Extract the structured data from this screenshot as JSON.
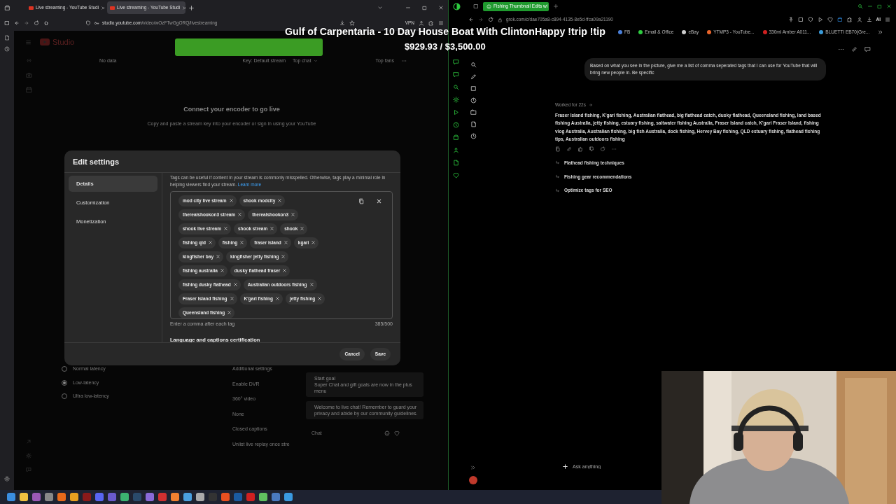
{
  "overlay": {
    "stream_title": "Gulf of Carpentaria - 10 Day House Boat With ClintonHappy !trip !tip",
    "goal": "$929.93 / $3,500.00"
  },
  "left_browser": {
    "tabs": [
      {
        "label": "Live streaming - YouTube Studi",
        "selected": false
      },
      {
        "label": "Live streaming - YouTube Studi",
        "selected": true
      }
    ],
    "url_host": "studio.youtube.com",
    "url_path": "/video/wOzFTwGgORQ/livestreaming",
    "vpn": "VPN"
  },
  "studio": {
    "logo": "Studio",
    "no_data": "No data",
    "stream_key": "Key: Default stream",
    "chat_mode": "Top chat",
    "top_fans": "Top fans",
    "heading": "Connect your encoder to go live",
    "subtext": "Copy and paste a stream key into your encoder or sign in using your YouTube",
    "latency_options": [
      {
        "label": "Normal latency",
        "selected": false
      },
      {
        "label": "Low-latency",
        "selected": true
      },
      {
        "label": "Ultra low-latency",
        "selected": false
      }
    ],
    "additional_settings": {
      "title": "Additional settings",
      "items": [
        "Enable DVR",
        "360° video",
        "None",
        "Closed captions",
        "Unlist live replay once stre"
      ]
    },
    "chat_messages": [
      {
        "title": "Start goal",
        "body": "Super Chat and gift goals are now in the plus menu"
      },
      {
        "body": "Welcome to live chat! Remember to guard your privacy and abide by our community guidelines."
      }
    ],
    "chat_placeholder": "Chat"
  },
  "dialog": {
    "title": "Edit settings",
    "nav": [
      {
        "label": "Details",
        "selected": true
      },
      {
        "label": "Customization",
        "selected": false
      },
      {
        "label": "Monetization",
        "selected": false
      }
    ],
    "help_text": "Tags can be useful if content in your stream is commonly misspelled. Otherwise, tags play a minimal role in helping viewers find your stream.",
    "help_link": "Learn more",
    "tags": [
      "mod city live stream",
      "shook modcity",
      "therealshookon3 stream",
      "therealshookon3",
      "shook live stream",
      "shook stream",
      "shook",
      "fishing qld",
      "fishing",
      "fraser island",
      "kgari",
      "kingfisher bay",
      "kingfisher jetty fishing",
      "fishing australia",
      "dusky flathead fraser",
      "fishing dusky flathead",
      "Australian outdoors fishing",
      "Fraser Island fishing",
      "K'gari fishing",
      "jetty fishing",
      "Queensland fishing"
    ],
    "hint": "Enter a comma after each tag",
    "counter": "385/500",
    "next_section": "Language and captions certification",
    "buttons": [
      "Cancel",
      "Save"
    ]
  },
  "right_browser": {
    "tab": {
      "label": "Fishing Thumbnail Edits wi",
      "selected": true
    },
    "url": "grok.com/c/dae705a8-c894-4135-8e5d-ffca09a21190",
    "ai_label": "AI",
    "bookmarks": [
      "FB",
      "Email & Office",
      "eBay",
      "YTMP3 - YouTube...",
      "330ml Amber A011...",
      "BLUETTI EB70(Gre..."
    ]
  },
  "grok": {
    "prompt": "Based on what you see in the picture, give me a list of comma seperated tags that I can use for YouTube that will bring new people in. Be specific",
    "status": "Worked for 22s",
    "answer": "Fraser Island fishing, K'gari fishing, Australian flathead, big flathead catch, dusky flathead, Queensland fishing, land based fishing Australia, jetty fishing, estuary fishing, saltwater fishing Australia, Fraser Island catch, K'gari Fraser Island, fishing vlog Australia, Australian fishing, big fish Australia, dock fishing, Hervey Bay fishing, QLD estuary fishing, flathead fishing tips, Australian outdoors fishing",
    "suggestions": [
      "Flathead fishing techniques",
      "Fishing gear recommendations",
      "Optimize tags for SEO"
    ],
    "input_placeholder": "Ask anything"
  }
}
